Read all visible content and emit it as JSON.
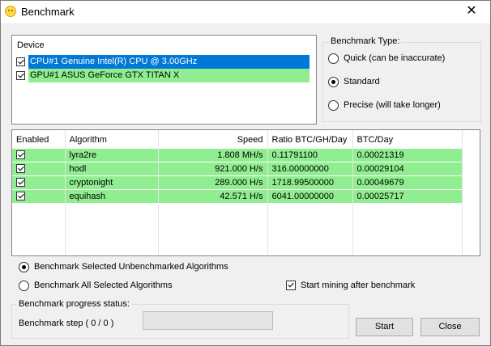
{
  "window": {
    "title": "Benchmark",
    "close_glyph": "✕"
  },
  "devices": {
    "header": "Device",
    "items": [
      {
        "label": "CPU#1 Genuine Intel(R) CPU @ 3.00GHz",
        "checked": true,
        "color": "#0078d7"
      },
      {
        "label": "GPU#1 ASUS GeForce GTX TITAN X",
        "checked": true,
        "color": "#90ee90"
      }
    ]
  },
  "benchmark_type": {
    "title": "Benchmark Type:",
    "options": [
      {
        "label": "Quick (can be inaccurate)",
        "selected": false
      },
      {
        "label": "Standard",
        "selected": true
      },
      {
        "label": "Precise (will take longer)",
        "selected": false
      }
    ]
  },
  "algorithms": {
    "columns": [
      "Enabled",
      "Algorithm",
      "Speed",
      "Ratio BTC/GH/Day",
      "BTC/Day"
    ],
    "rows": [
      {
        "enabled": true,
        "algorithm": "lyra2re",
        "speed": "1.808 MH/s",
        "ratio": "0.11791100",
        "btc_day": "0.00021319"
      },
      {
        "enabled": true,
        "algorithm": "hodl",
        "speed": "921.000 H/s",
        "ratio": "316.00000000",
        "btc_day": "0.00029104"
      },
      {
        "enabled": true,
        "algorithm": "cryptonight",
        "speed": "289.000 H/s",
        "ratio": "1718.99500000",
        "btc_day": "0.00049679"
      },
      {
        "enabled": true,
        "algorithm": "equihash",
        "speed": "42.571 H/s",
        "ratio": "6041.00000000",
        "btc_day": "0.00025717"
      }
    ],
    "row_color": "#90ee90"
  },
  "options": {
    "selected_unbenchmarked": {
      "label": "Benchmark Selected Unbenchmarked Algorithms",
      "selected": true
    },
    "all_selected": {
      "label": "Benchmark All Selected Algorithms",
      "selected": false
    },
    "start_mining": {
      "label": "Start mining after benchmark",
      "checked": false
    }
  },
  "progress": {
    "title": "Benchmark progress status:",
    "step_text": "Benchmark step ( 0 / 0 )",
    "fraction": 0
  },
  "buttons": {
    "start": "Start",
    "close": "Close"
  }
}
